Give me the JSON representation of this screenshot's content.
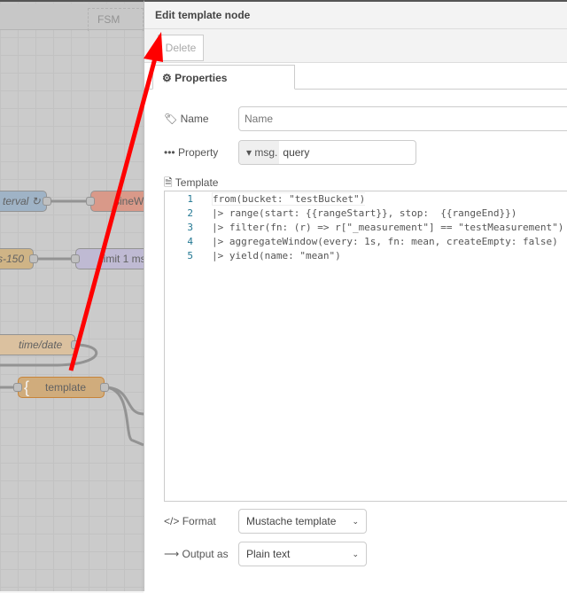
{
  "canvas": {
    "tab_label": "FSM",
    "nodes": [
      {
        "label": "terval ↻",
        "color": "#a6bbcf"
      },
      {
        "label": "sineW",
        "color": "#e2a08f"
      },
      {
        "label": "s-150",
        "color": "#d8bc8c"
      },
      {
        "label": "limit 1 ms",
        "color": "#c7c2dc"
      },
      {
        "label": "time/date",
        "color": "#e4c9a6"
      },
      {
        "label": "template",
        "color": "#d9b382"
      }
    ]
  },
  "panel": {
    "title": "Edit template node",
    "delete_label": "Delete",
    "tab_label": "Properties",
    "name_label": "Name",
    "name_value": "",
    "name_placeholder": "Name",
    "property_label": "Property",
    "property_prefix": "msg.",
    "property_value": "query",
    "template_label": "Template",
    "code_lines": [
      {
        "n": "1",
        "text": "from(bucket: \"testBucket\")"
      },
      {
        "n": "2",
        "text": "|> range(start: {{rangeStart}}, stop:  {{rangeEnd}})"
      },
      {
        "n": "3",
        "text": "|> filter(fn: (r) => r[\"_measurement\"] == \"testMeasurement\")"
      },
      {
        "n": "4",
        "text": "|> aggregateWindow(every: 1s, fn: mean, createEmpty: false)"
      },
      {
        "n": "5",
        "text": "|> yield(name: \"mean\")"
      }
    ],
    "format_label": "Format",
    "format_value": "Mustache template",
    "output_label": "Output as",
    "output_value": "Plain text"
  },
  "annotation_color": "#ff0000"
}
